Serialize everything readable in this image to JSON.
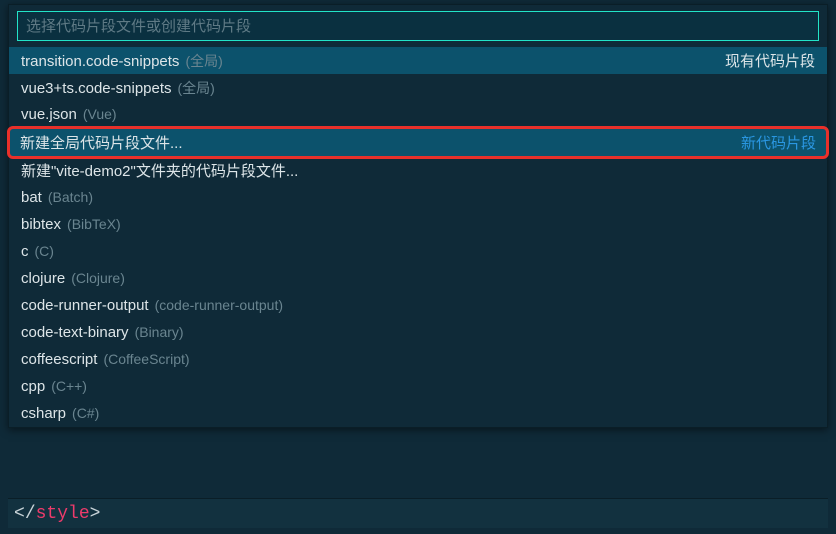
{
  "search": {
    "placeholder": "选择代码片段文件或创建代码片段",
    "value": ""
  },
  "sections": {
    "existing_label": "现有代码片段",
    "new_label": "新代码片段"
  },
  "items": [
    {
      "label": "transition.code-snippets",
      "detail": "(全局)",
      "right": "现有代码片段",
      "selected": true
    },
    {
      "label": "vue3+ts.code-snippets",
      "detail": "(全局)"
    },
    {
      "label": "vue.json",
      "detail": "(Vue)"
    },
    {
      "label": "新建全局代码片段文件...",
      "detail": "",
      "right": "新代码片段",
      "highlighted": true,
      "right_link": true
    },
    {
      "label": "新建\"vite-demo2\"文件夹的代码片段文件...",
      "detail": ""
    },
    {
      "label": "bat",
      "detail": "(Batch)"
    },
    {
      "label": "bibtex",
      "detail": "(BibTeX)"
    },
    {
      "label": "c",
      "detail": "(C)"
    },
    {
      "label": "clojure",
      "detail": "(Clojure)"
    },
    {
      "label": "code-runner-output",
      "detail": "(code-runner-output)"
    },
    {
      "label": "code-text-binary",
      "detail": "(Binary)"
    },
    {
      "label": "coffeescript",
      "detail": "(CoffeeScript)"
    },
    {
      "label": "cpp",
      "detail": "(C++)"
    },
    {
      "label": "csharp",
      "detail": "(C#)"
    }
  ],
  "editor": {
    "bracket_open": "<",
    "slash": "/",
    "tag": "style",
    "bracket_close": ">"
  }
}
